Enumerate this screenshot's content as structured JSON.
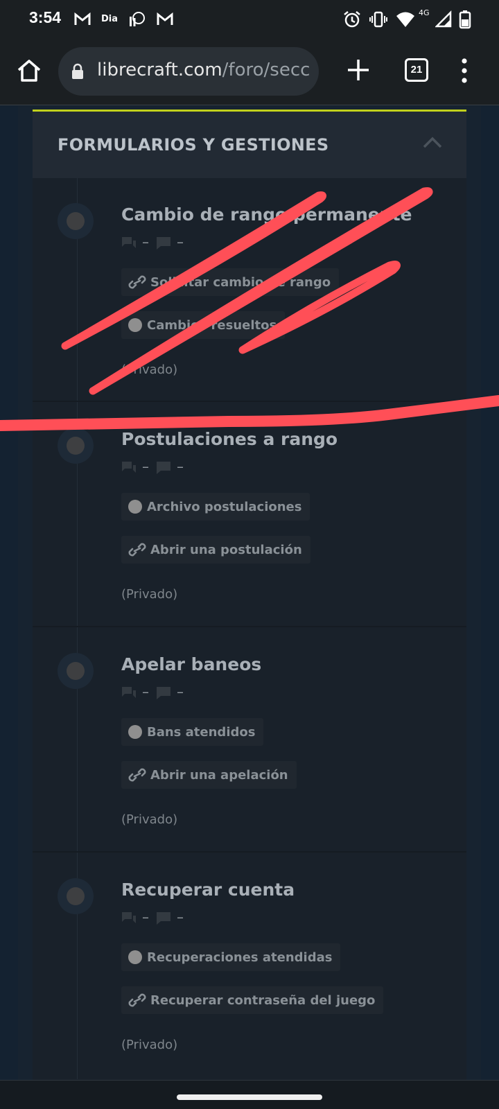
{
  "status_bar": {
    "time": "3:54",
    "left_icons": [
      "gmail-icon",
      "dia-app-icon",
      "ip-app-icon",
      "gmail-icon"
    ],
    "dia_label": "Dia",
    "network_label": "4G",
    "right_icons": [
      "alarm-icon",
      "vibrate-icon",
      "wifi-icon",
      "signal-icon",
      "battery-icon"
    ]
  },
  "browser": {
    "url_domain": "librecraft.com",
    "url_path": "/foro/secc",
    "tab_count": "21",
    "icons": [
      "home-icon",
      "lock-icon",
      "plus-icon",
      "tabs-icon",
      "more-vert-icon"
    ]
  },
  "section": {
    "title": "FORMULARIOS Y GESTIONES",
    "accent_color": "#c2d11c",
    "collapse_icon": "chevron-up-icon"
  },
  "forums": [
    {
      "title": "Cambio de rango permanente",
      "threads": "–",
      "messages": "–",
      "subforums": [
        {
          "type": "link",
          "label": "Solicitar cambio de rango"
        },
        {
          "type": "forum",
          "label": "Cambios resueltos"
        }
      ],
      "note": "(Privado)"
    },
    {
      "title": "Postulaciones a rango",
      "threads": "–",
      "messages": "–",
      "subforums": [
        {
          "type": "forum",
          "label": "Archivo postulaciones"
        },
        {
          "type": "link",
          "label": "Abrir una postulación"
        }
      ],
      "note": "(Privado)"
    },
    {
      "title": "Apelar baneos",
      "threads": "–",
      "messages": "–",
      "subforums": [
        {
          "type": "forum",
          "label": "Bans atendidos"
        },
        {
          "type": "link",
          "label": "Abrir una apelación"
        }
      ],
      "note": "(Privado)"
    },
    {
      "title": "Recuperar cuenta",
      "threads": "–",
      "messages": "–",
      "subforums": [
        {
          "type": "forum",
          "label": "Recuperaciones atendidas"
        },
        {
          "type": "link",
          "label": "Recuperar contraseña del juego"
        }
      ],
      "note": "(Privado)"
    }
  ],
  "annotation": {
    "color": "#ff4f57"
  }
}
